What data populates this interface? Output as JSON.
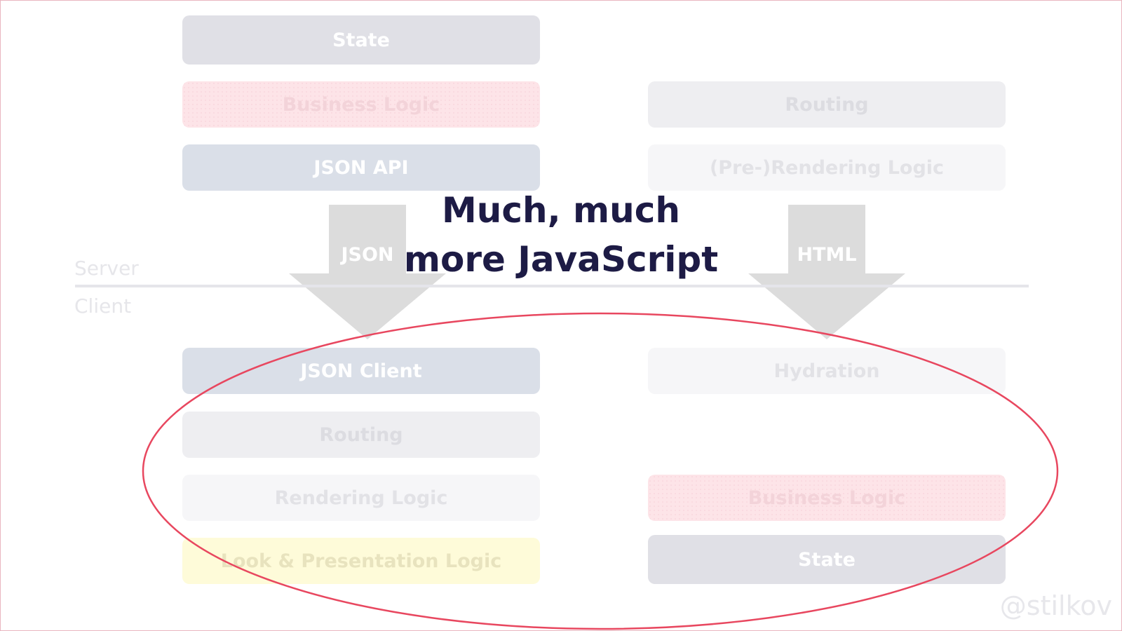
{
  "server": {
    "left": [
      "State",
      "Business Logic",
      "JSON API"
    ],
    "right": [
      "Routing",
      "(Pre-)Rendering Logic"
    ]
  },
  "labels": {
    "server": "Server",
    "client": "Client"
  },
  "arrows": {
    "left": "JSON",
    "right": "HTML"
  },
  "headline": {
    "line1": "Much, much",
    "line2": "more JavaScript"
  },
  "client": {
    "left": [
      "JSON Client",
      "Routing",
      "Rendering Logic",
      "Look & Presentation Logic"
    ],
    "right": [
      "Hydration",
      "Business Logic",
      "State"
    ]
  },
  "handle": "@stilkov",
  "colors": {
    "highlight_ellipse": "#e8475f",
    "headline": "#1d1b45"
  }
}
